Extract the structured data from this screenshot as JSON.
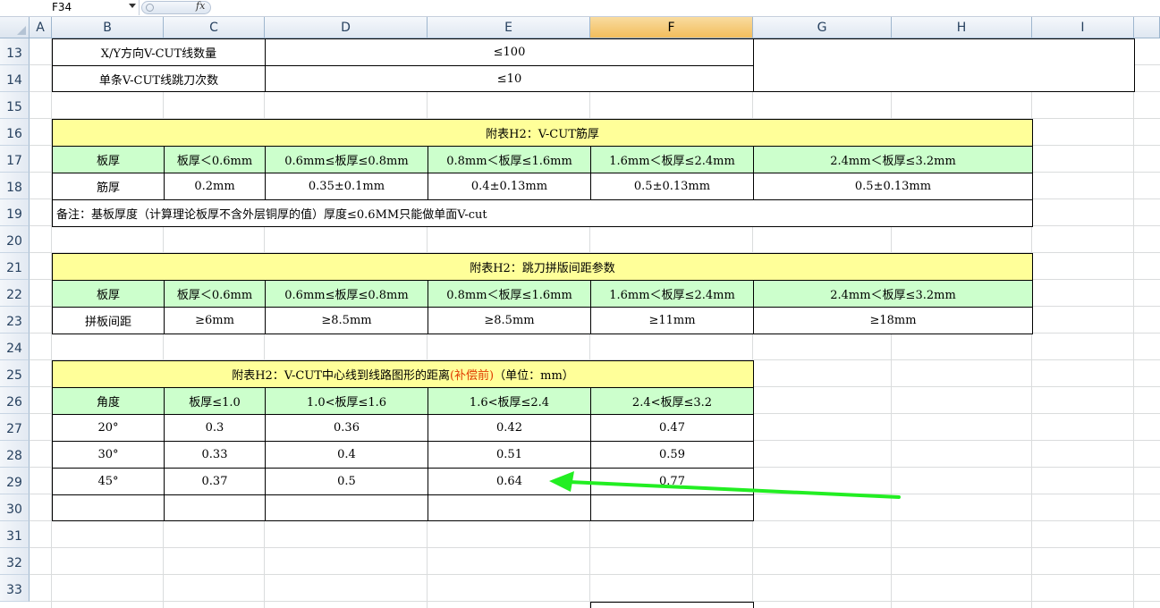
{
  "formula_bar": {
    "name_box": "F34",
    "fx_label": "fx",
    "formula": ""
  },
  "columns": [
    "A",
    "B",
    "C",
    "D",
    "E",
    "F",
    "G",
    "H",
    "I"
  ],
  "rows": [
    "13",
    "14",
    "15",
    "16",
    "17",
    "18",
    "19",
    "20",
    "21",
    "22",
    "23",
    "24",
    "25",
    "26",
    "27",
    "28",
    "29",
    "30",
    "31",
    "32",
    "33"
  ],
  "table0": {
    "row13": {
      "label": "X/Y方向V-CUT线数量",
      "value": "≤100"
    },
    "row14": {
      "label": "单条V-CUT线跳刀次数",
      "value": "≤10"
    }
  },
  "table1": {
    "title": "附表H2：V-CUT筋厚",
    "header": [
      "板厚",
      "板厚＜0.6mm",
      "0.6mm≤板厚≤0.8mm",
      "0.8mm＜板厚≤1.6mm",
      "1.6mm＜板厚≤2.4mm",
      "2.4mm＜板厚≤3.2mm"
    ],
    "row": [
      "筋厚",
      "0.2mm",
      "0.35±0.1mm",
      "0.4±0.13mm",
      "0.5±0.13mm",
      "0.5±0.13mm"
    ],
    "note": "备注：基板厚度（计算理论板厚不含外层铜厚的值）厚度≤0.6MM只能做单面V-cut"
  },
  "table2": {
    "title": "附表H2：跳刀拼版间距参数",
    "header": [
      "板厚",
      "板厚＜0.6mm",
      "0.6mm≤板厚≤0.8mm",
      "0.8mm＜板厚≤1.6mm",
      "1.6mm＜板厚≤2.4mm",
      "2.4mm＜板厚≤3.2mm"
    ],
    "row": [
      "拼板间距",
      "≥6mm",
      "≥8.5mm",
      "≥8.5mm",
      "≥11mm",
      "≥18mm"
    ]
  },
  "table3": {
    "title_a": "附表H2：V-CUT中心线到线路图形的距离",
    "title_b": "(补偿前)",
    "title_c": "（单位：mm）",
    "header": [
      "角度",
      "板厚≤1.0",
      "1.0<板厚≤1.6",
      "1.6<板厚≤2.4",
      "2.4<板厚≤3.2"
    ],
    "rows": [
      [
        "20°",
        "0.3",
        "0.36",
        "0.42",
        "0.47"
      ],
      [
        "30°",
        "0.33",
        "0.4",
        "0.51",
        "0.59"
      ],
      [
        "45°",
        "0.37",
        "0.5",
        "0.64",
        "0.77"
      ]
    ]
  },
  "colors": {
    "header_yellow": "#ffff99",
    "header_green": "#ccffcc",
    "arrow_green": "#22ee22",
    "selected_column": "#f2bd5c"
  },
  "selected_column": "F"
}
